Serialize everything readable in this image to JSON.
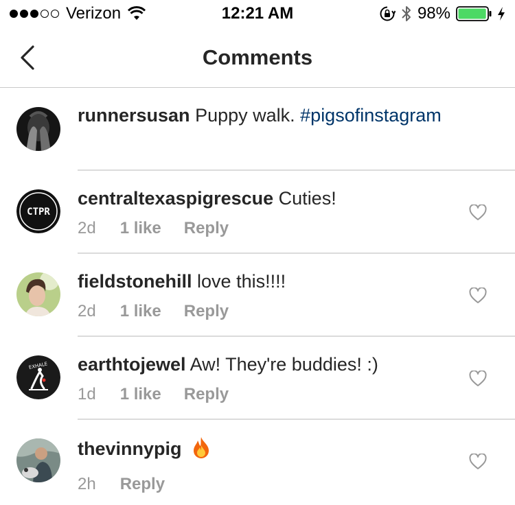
{
  "status_bar": {
    "carrier": "Verizon",
    "time": "12:21 AM",
    "battery_percent": "98%",
    "signal_bars_filled": 3,
    "signal_bars_total": 5,
    "battery_level": 0.98,
    "battery_color": "#4cd964",
    "icons": [
      "signal-dots-icon",
      "wifi-icon",
      "rotation-lock-icon",
      "bluetooth-icon",
      "battery-icon",
      "charging-bolt-icon"
    ]
  },
  "nav": {
    "title": "Comments",
    "back_icon": "chevron-left-icon"
  },
  "caption": {
    "username": "runnersusan",
    "text": "Puppy walk.",
    "hashtag": "#pigsofinstagram",
    "hashtag_color": "#003569"
  },
  "comments": [
    {
      "username": "centraltexaspigrescue",
      "text": "Cuties!",
      "age": "2d",
      "likes": "1 like",
      "reply": "Reply",
      "avatar_text": "CTPR"
    },
    {
      "username": "fieldstonehill",
      "text": "love this!!!!",
      "age": "2d",
      "likes": "1 like",
      "reply": "Reply"
    },
    {
      "username": "earthtojewel",
      "text": "Aw! They're buddies! :)",
      "age": "1d",
      "likes": "1 like",
      "reply": "Reply",
      "avatar_text": "EXHALE"
    },
    {
      "username": "thevinnypig",
      "text": "",
      "emoji": "fire-emoji",
      "age": "2h",
      "reply": "Reply"
    }
  ],
  "colors": {
    "text": "#262626",
    "meta": "#999999",
    "divider": "#dbdbdb"
  }
}
